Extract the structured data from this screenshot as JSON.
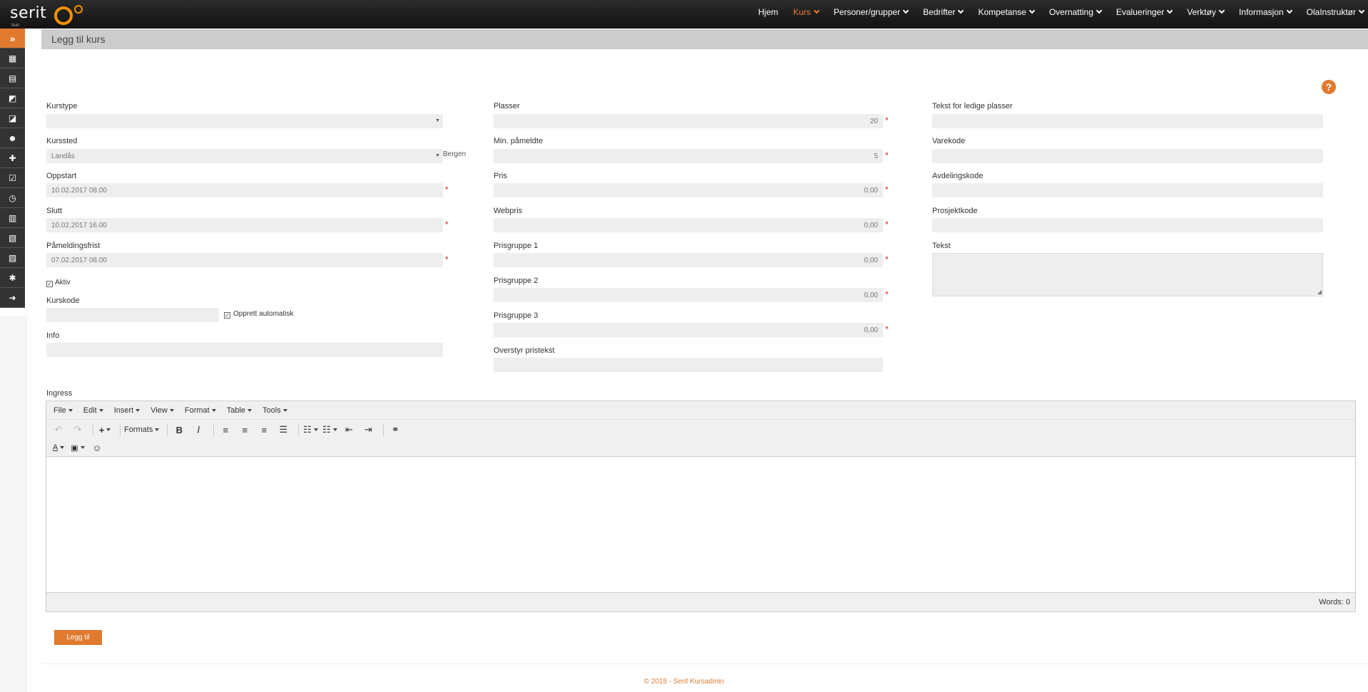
{
  "brand": {
    "name": "serit",
    "tagline": "Ituin",
    "accent": "#f39200"
  },
  "nav": {
    "items": [
      {
        "label": "Hjem",
        "dropdown": false
      },
      {
        "label": "Kurs",
        "dropdown": true,
        "active": true
      },
      {
        "label": "Personer/grupper",
        "dropdown": true
      },
      {
        "label": "Bedrifter",
        "dropdown": true
      },
      {
        "label": "Kompetanse",
        "dropdown": true
      },
      {
        "label": "Overnatting",
        "dropdown": true
      },
      {
        "label": "Evalueringer",
        "dropdown": true
      },
      {
        "label": "Verktøy",
        "dropdown": true
      },
      {
        "label": "Informasjon",
        "dropdown": true
      },
      {
        "label": "OlaInstruktør",
        "dropdown": true
      }
    ]
  },
  "sidebar": {
    "toggle_icon": "»",
    "items": [
      {
        "name": "calendar-icon",
        "glyph": "▦"
      },
      {
        "name": "schedule-icon",
        "glyph": "▤"
      },
      {
        "name": "course-search-icon",
        "glyph": "◩"
      },
      {
        "name": "course-list-icon",
        "glyph": "◪"
      },
      {
        "name": "person-search-icon",
        "glyph": "☻"
      },
      {
        "name": "add-person-icon",
        "glyph": "✚"
      },
      {
        "name": "checklist-icon",
        "glyph": "☑"
      },
      {
        "name": "clock-icon",
        "glyph": "◷"
      },
      {
        "name": "document-icon",
        "glyph": "▥"
      },
      {
        "name": "report-icon",
        "glyph": "▧"
      },
      {
        "name": "add-document-icon",
        "glyph": "▨"
      },
      {
        "name": "settings-icon",
        "glyph": "✱"
      },
      {
        "name": "logout-icon",
        "glyph": "➜"
      }
    ]
  },
  "page": {
    "title": "Legg til kurs",
    "help_icon": "?"
  },
  "form": {
    "kurstype": {
      "label": "Kurstype",
      "value": ""
    },
    "kurssted": {
      "label": "Kurssted",
      "value": "Landås",
      "suffix": "Bergen"
    },
    "oppstart": {
      "label": "Oppstart",
      "value": "10.02.2017 08.00"
    },
    "slutt": {
      "label": "Slutt",
      "value": "10.02.2017 16.00"
    },
    "pameldingsfrist": {
      "label": "Påmeldingsfrist",
      "value": "07.02.2017 08.00"
    },
    "aktiv": {
      "label": "Aktiv",
      "checked": true
    },
    "kurskode": {
      "label": "Kurskode",
      "value": ""
    },
    "opprett_auto": {
      "label": "Opprett automatisk",
      "checked": true
    },
    "info": {
      "label": "Info",
      "value": ""
    },
    "plasser": {
      "label": "Plasser",
      "value": "20"
    },
    "min_pameldte": {
      "label": "Min. påmeldte",
      "value": "5"
    },
    "pris": {
      "label": "Pris",
      "value": "0,00"
    },
    "webpris": {
      "label": "Webpris",
      "value": "0,00"
    },
    "prisgruppe1": {
      "label": "Prisgruppe 1",
      "value": "0,00"
    },
    "prisgruppe2": {
      "label": "Prisgruppe 2",
      "value": "0,00"
    },
    "prisgruppe3": {
      "label": "Prisgruppe 3",
      "value": "0,00"
    },
    "overstyr_pristekst": {
      "label": "Overstyr pristekst",
      "value": ""
    },
    "tekst_ledige": {
      "label": "Tekst for ledige plasser",
      "value": ""
    },
    "varekode": {
      "label": "Varekode",
      "value": ""
    },
    "avdelingskode": {
      "label": "Avdelingskode",
      "value": ""
    },
    "prosjektkode": {
      "label": "Prosjektkode",
      "value": ""
    },
    "tekst": {
      "label": "Tekst",
      "value": ""
    },
    "required_mark": "*",
    "ingress_label": "Ingress"
  },
  "editor": {
    "menus": [
      "File",
      "Edit",
      "Insert",
      "View",
      "Format",
      "Table",
      "Tools"
    ],
    "formats_label": "Formats",
    "words": "Words: 0"
  },
  "actions": {
    "submit_label": "Legg til"
  },
  "footer": {
    "text": "© 2015 - Serit Kursadmin"
  },
  "colors": {
    "accent": "#e07a2e",
    "required": "#e02020",
    "header_bg": "#cccccc",
    "field_bg": "#eeeeee"
  }
}
